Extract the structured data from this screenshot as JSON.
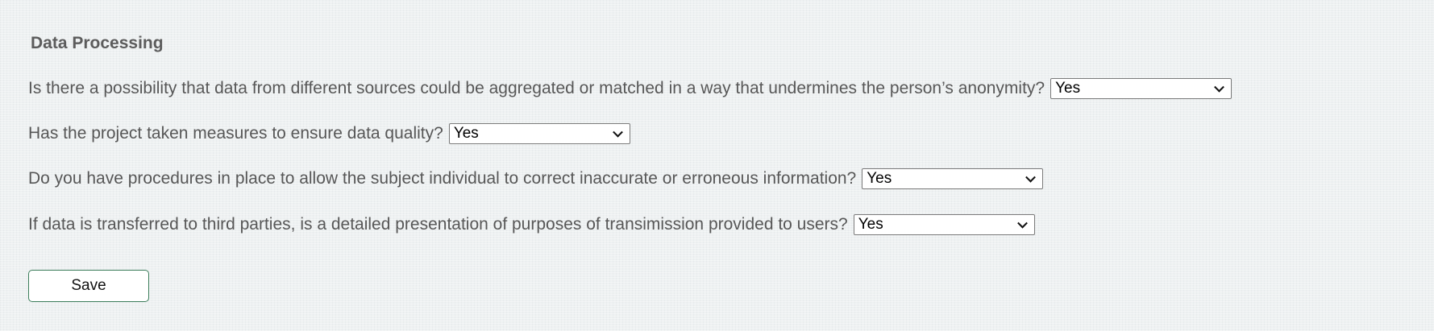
{
  "form": {
    "section_title": "Data Processing",
    "questions": [
      {
        "text": "Is there a possibility that data from different sources could be aggregated or matched in a way that undermines the person’s anonymity?",
        "selected": "Yes"
      },
      {
        "text": "Has the project taken measures to ensure data quality?",
        "selected": "Yes"
      },
      {
        "text": "Do you have procedures in place to allow the subject individual to correct inaccurate or erroneous information?",
        "selected": "Yes"
      },
      {
        "text": "If data is transferred to third parties, is a detailed presentation of purposes of transimission provided to users?",
        "selected": "Yes"
      }
    ],
    "save_label": "Save"
  },
  "icons": {
    "dropdown": "chevron-down-icon"
  }
}
